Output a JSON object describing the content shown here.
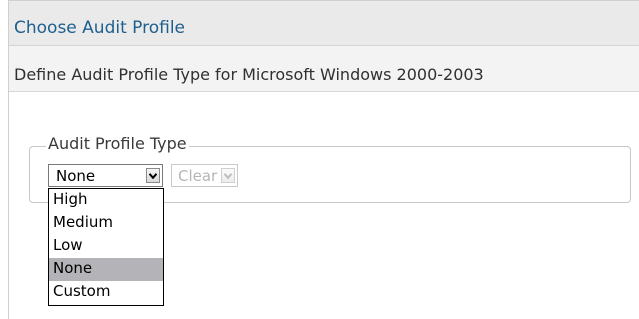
{
  "header": {
    "title": "Choose Audit Profile",
    "description": "Define Audit Profile Type for Microsoft Windows 2000-2003"
  },
  "audit_profile_group": {
    "legend": "Audit Profile Type",
    "profile_select": {
      "value": "None",
      "options": [
        "High",
        "Medium",
        "Low",
        "None",
        "Custom"
      ],
      "highlighted_option": "None"
    },
    "clear_select": {
      "value": "Clear",
      "disabled": true
    }
  },
  "colors": {
    "title_text": "#1e5f8e",
    "title_bar_bg": "#eaeaea",
    "description_bar_bg": "#f3f3f3",
    "highlighted_option_bg": "#b3b3b8"
  },
  "icons": {
    "dropdown_arrow": "chevron-down-icon"
  }
}
